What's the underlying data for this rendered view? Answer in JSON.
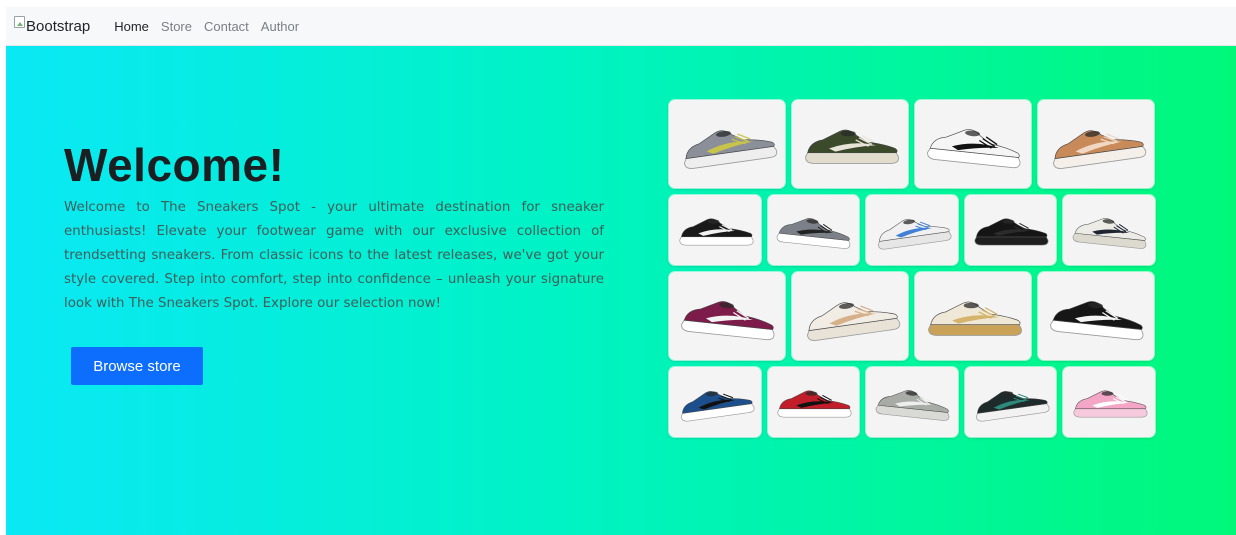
{
  "nav": {
    "brand_alt": "Bootstrap",
    "links": [
      "Home",
      "Store",
      "Contact",
      "Author"
    ],
    "active": "Home"
  },
  "hero": {
    "title": "Welcome!",
    "text": "Welcome to The Sneakers Spot - your ultimate destination for sneaker enthusiasts! Elevate your footwear game with our exclusive collection of trendsetting sneakers. From classic icons to the latest releases, we've got your style covered. Step into comfort, step into confidence – unleash your signature look with The Sneakers Spot. Explore our selection now!",
    "button": "Browse store"
  },
  "colors": {
    "gradient_left": "#0ae8f5",
    "gradient_right": "#00f87a",
    "button": "#0d6efd",
    "navbar_bg": "#f7f8f9"
  },
  "sneakers": [
    [
      {
        "name": "grey-yellow-runner-sneaker",
        "upper": "#8a8f9a",
        "accent": "#c8c44a",
        "sole": "#eeeeee"
      },
      {
        "name": "green-new-balance-sneaker",
        "upper": "#3b4a2a",
        "accent": "#e8e4d8",
        "sole": "#e2dccc"
      },
      {
        "name": "white-adidas-forum-sneaker",
        "upper": "#f5f5f5",
        "accent": "#111111",
        "sole": "#ffffff"
      },
      {
        "name": "tan-high-top-sneaker",
        "upper": "#c98a5a",
        "accent": "#f0d8c4",
        "sole": "#f4efe8"
      }
    ],
    [
      {
        "name": "checkered-vans-sneaker",
        "upper": "#1a1a1a",
        "accent": "#f2f2f2",
        "sole": "#ffffff"
      },
      {
        "name": "grey-black-dunk-sneaker",
        "upper": "#7c8088",
        "accent": "#222222",
        "sole": "#ffffff"
      },
      {
        "name": "white-blue-asics-sneaker",
        "upper": "#f0f0f0",
        "accent": "#3f7fd6",
        "sole": "#e6e6e6"
      },
      {
        "name": "black-air-max-sneaker",
        "upper": "#151515",
        "accent": "#2b2b2b",
        "sole": "#1f1f1f"
      },
      {
        "name": "white-new-balance-sneaker",
        "upper": "#ecebe6",
        "accent": "#1f2530",
        "sole": "#dcd9cf"
      }
    ],
    [
      {
        "name": "maroon-vans-platform-sneaker",
        "upper": "#7d1b4a",
        "accent": "#f3f3f3",
        "sole": "#ffffff"
      },
      {
        "name": "beige-air-max-sneaker",
        "upper": "#f1ede4",
        "accent": "#d6b088",
        "sole": "#e8e3d6"
      },
      {
        "name": "cream-air-max-270-sneaker",
        "upper": "#efe8d6",
        "accent": "#d4b46a",
        "sole": "#c9a258"
      },
      {
        "name": "black-vans-knu-sneaker",
        "upper": "#161616",
        "accent": "#f5f5f5",
        "sole": "#ffffff"
      }
    ],
    [
      {
        "name": "blue-black-dunk-sneaker",
        "upper": "#1d4f8c",
        "accent": "#111111",
        "sole": "#ffffff"
      },
      {
        "name": "red-black-jordan-sneaker",
        "upper": "#c21d2a",
        "accent": "#111111",
        "sole": "#ffffff"
      },
      {
        "name": "grey-new-balance-sneaker",
        "upper": "#a9aca6",
        "accent": "#eeeeee",
        "sole": "#d9d9d6"
      },
      {
        "name": "black-green-adidas-sneaker",
        "upper": "#1e2b2a",
        "accent": "#2d8a7a",
        "sole": "#f2f2f2"
      },
      {
        "name": "pink-adidas-sneaker",
        "upper": "#f3a6c6",
        "accent": "#ffffff",
        "sole": "#f7c9dc"
      }
    ]
  ]
}
